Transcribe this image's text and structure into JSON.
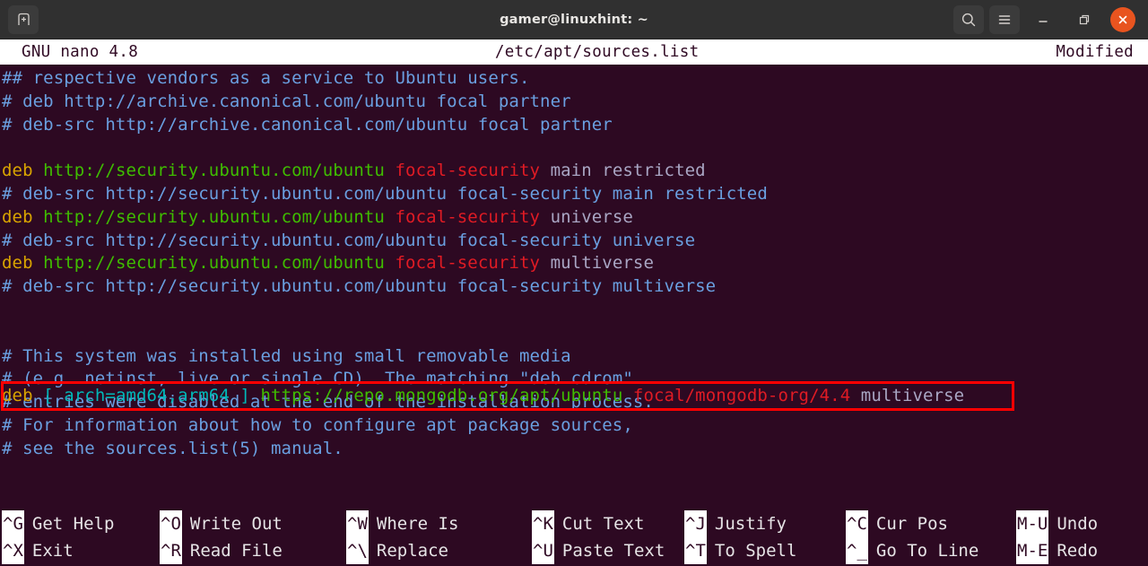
{
  "titlebar": {
    "title": "gamer@linuxhint: ~",
    "new_tab_icon": "new-tab-icon",
    "search_icon": "search-icon",
    "menu_icon": "hamburger-menu-icon",
    "minimize_icon": "minimize-icon",
    "maximize_icon": "maximize-icon",
    "close_icon": "close-icon",
    "accent_close": "#e8541f",
    "background": "#303030"
  },
  "nano_header": {
    "version": "GNU nano 4.8",
    "filename": "/etc/apt/sources.list",
    "status": "Modified"
  },
  "editor": {
    "background": "#2d0922",
    "lines": [
      {
        "type": "comment",
        "text": "## respective vendors as a service to Ubuntu users."
      },
      {
        "type": "comment",
        "text": "# deb http://archive.canonical.com/ubuntu focal partner"
      },
      {
        "type": "comment",
        "text": "# deb-src http://archive.canonical.com/ubuntu focal partner"
      },
      {
        "type": "blank",
        "text": ""
      },
      {
        "type": "deb",
        "keyword": "deb",
        "url": "http://security.ubuntu.com/ubuntu",
        "suite": "focal-security",
        "components": "main restricted"
      },
      {
        "type": "comment",
        "text": "# deb-src http://security.ubuntu.com/ubuntu focal-security main restricted"
      },
      {
        "type": "deb",
        "keyword": "deb",
        "url": "http://security.ubuntu.com/ubuntu",
        "suite": "focal-security",
        "components": "universe"
      },
      {
        "type": "comment",
        "text": "# deb-src http://security.ubuntu.com/ubuntu focal-security universe"
      },
      {
        "type": "deb",
        "keyword": "deb",
        "url": "http://security.ubuntu.com/ubuntu",
        "suite": "focal-security",
        "components": "multiverse"
      },
      {
        "type": "comment",
        "text": "# deb-src http://security.ubuntu.com/ubuntu focal-security multiverse"
      },
      {
        "type": "blank",
        "text": ""
      },
      {
        "type": "comment",
        "text": "# This system was installed using small removable media"
      },
      {
        "type": "comment",
        "text": "# (e.g. netinst, live or single CD). The matching \"deb cdrom\""
      },
      {
        "type": "comment",
        "text": "# entries were disabled at the end of the installation process."
      },
      {
        "type": "comment",
        "text": "# For information about how to configure apt package sources,"
      },
      {
        "type": "comment",
        "text": "# see the sources.list(5) manual."
      }
    ],
    "highlighted_line": {
      "keyword": "deb",
      "options": "[ arch=amd64,arm64 ]",
      "url": "https://repo.mongodb.org/apt/ubuntu",
      "suite": "focal/mongodb-org/4.4",
      "components": "multiverse",
      "highlight_color": "#ff0000"
    },
    "colors": {
      "comment": "#6a9fe0",
      "keyword": "#d9a400",
      "url": "#3fbd00",
      "suite": "#e01b24",
      "components": "#a9a6c4",
      "options": "#00b8b8"
    }
  },
  "shortcuts": {
    "columns": [
      {
        "rows": [
          {
            "key": "^G",
            "label": "Get Help"
          },
          {
            "key": "^X",
            "label": "Exit"
          }
        ]
      },
      {
        "rows": [
          {
            "key": "^O",
            "label": "Write Out"
          },
          {
            "key": "^R",
            "label": "Read File"
          }
        ]
      },
      {
        "rows": [
          {
            "key": "^W",
            "label": "Where Is"
          },
          {
            "key": "^\\",
            "label": "Replace"
          }
        ]
      },
      {
        "rows": [
          {
            "key": "^K",
            "label": "Cut Text"
          },
          {
            "key": "^U",
            "label": "Paste Text"
          }
        ]
      },
      {
        "rows": [
          {
            "key": "^J",
            "label": "Justify"
          },
          {
            "key": "^T",
            "label": "To Spell"
          }
        ]
      },
      {
        "rows": [
          {
            "key": "^C",
            "label": "Cur Pos"
          },
          {
            "key": "^_",
            "label": "Go To Line"
          }
        ]
      },
      {
        "rows": [
          {
            "key": "M-U",
            "label": "Undo"
          },
          {
            "key": "M-E",
            "label": "Redo"
          }
        ]
      }
    ]
  }
}
